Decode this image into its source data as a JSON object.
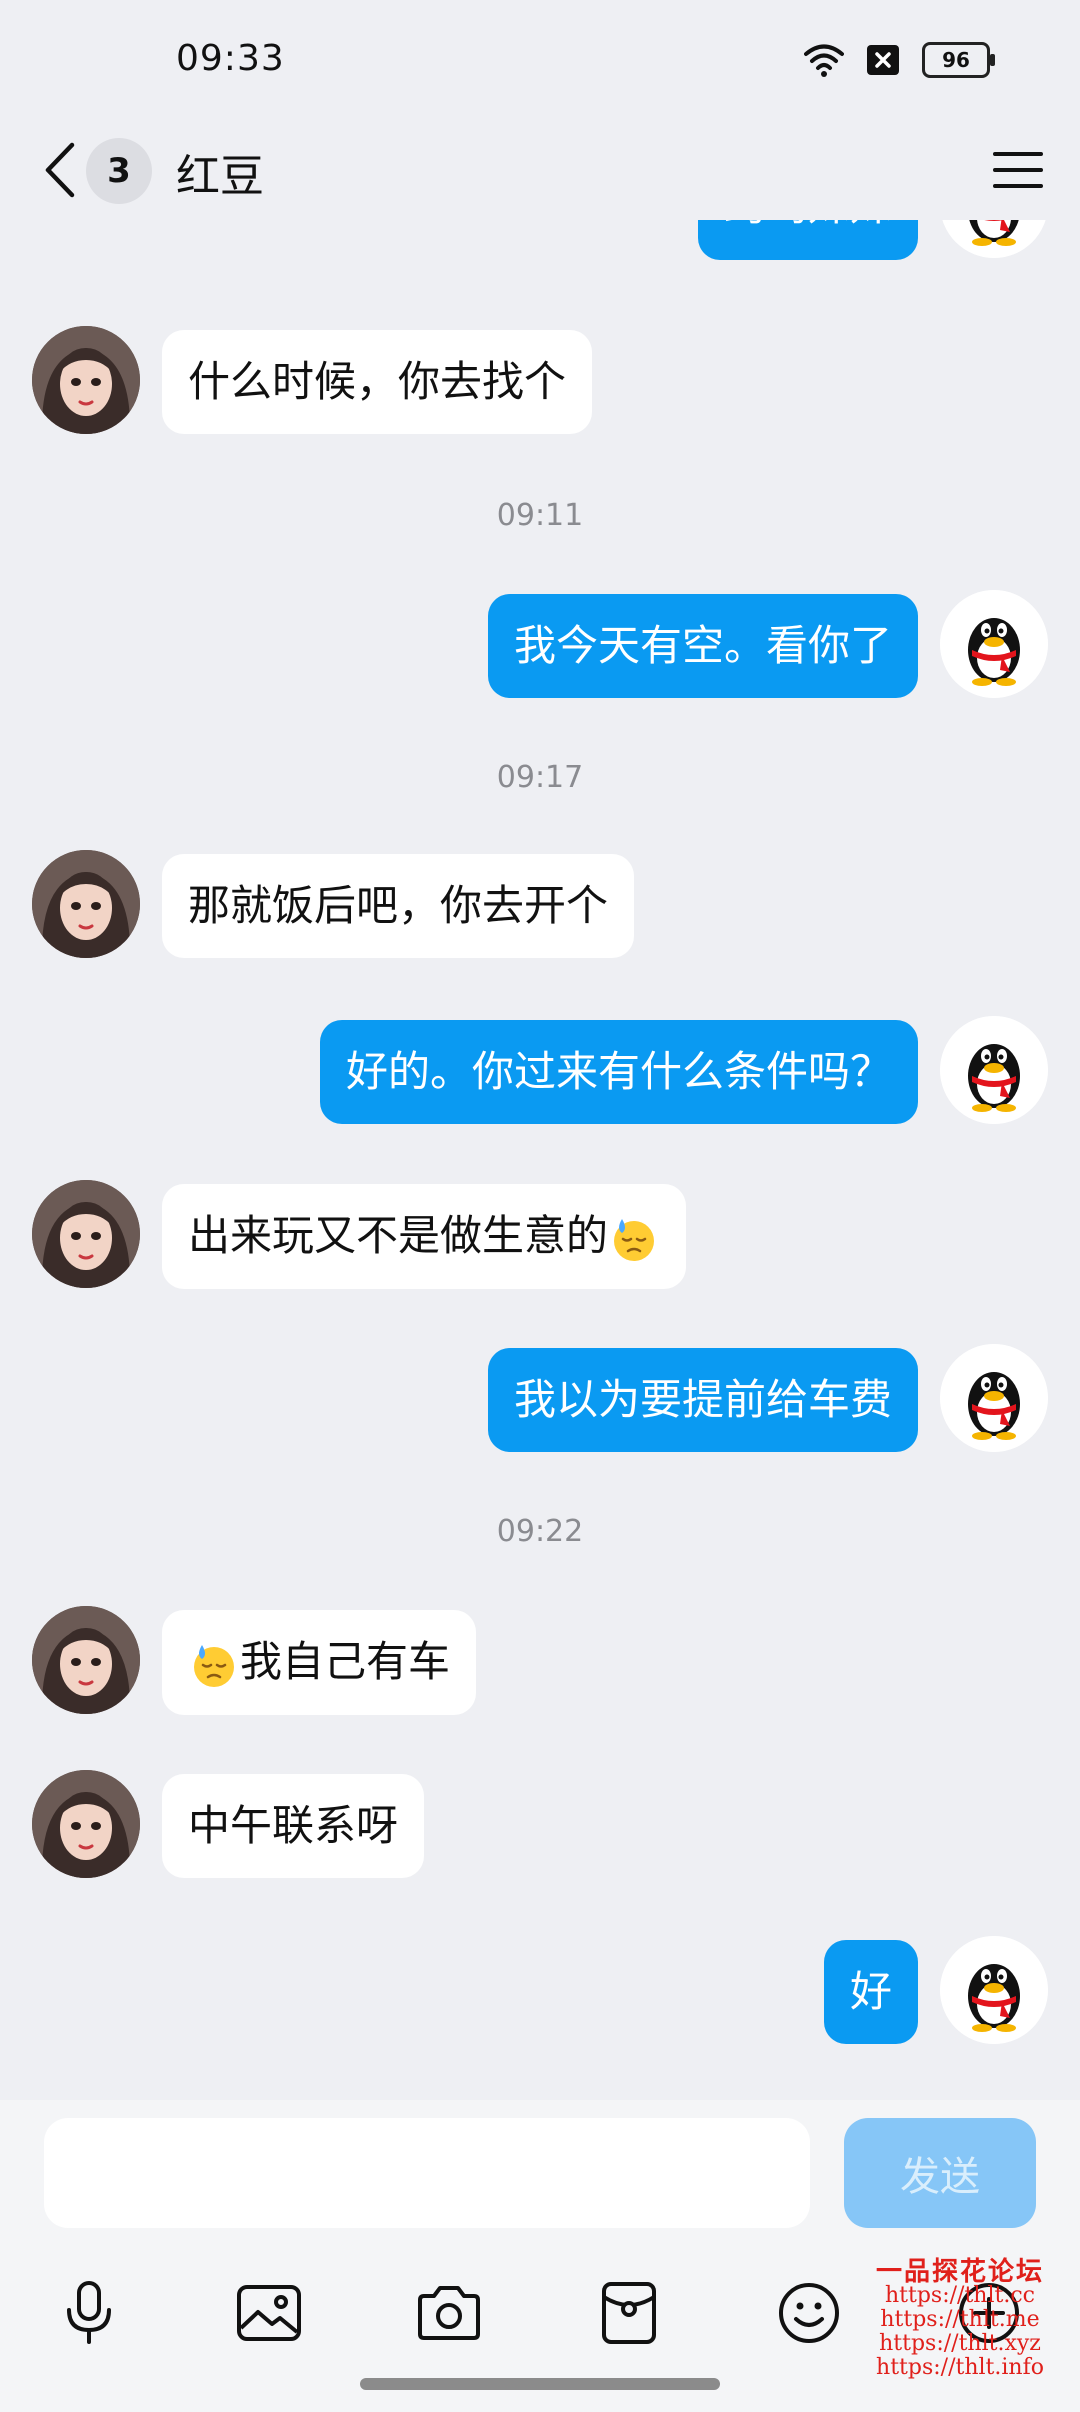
{
  "status_bar": {
    "time": "09:33",
    "battery": "96"
  },
  "header": {
    "unread_count": "3",
    "title": "红豆"
  },
  "messages": {
    "top_partial": "约吗妹妹",
    "m1": "什么时候，你去找个",
    "t1": "09:11",
    "m2": "我今天有空。看你了",
    "t2": "09:17",
    "m3": "那就饭后吧，你去开个",
    "m4": "好的。你过来有什么条件吗？",
    "m5": "出来玩又不是做生意的",
    "m6": "我以为要提前给车费",
    "t3": "09:22",
    "m7": "我自己有车",
    "m8": "中午联系呀",
    "m9": "好"
  },
  "input": {
    "placeholder": "",
    "value": "",
    "send_label": "发送"
  },
  "toolbar": {
    "icons": [
      "microphone-icon",
      "image-icon",
      "camera-icon",
      "red-packet-icon",
      "emoji-icon",
      "plus-icon"
    ]
  },
  "watermark": {
    "title": "一品探花论坛",
    "lines": [
      "https://thlt.cc",
      "https://thlt.me",
      "https://thlt.xyz",
      "https://thlt.info"
    ]
  },
  "colors": {
    "accent": "#0a9af2",
    "send_disabled": "#86c6f7",
    "background": "#eeeff3",
    "bubble_left": "#ffffff"
  }
}
